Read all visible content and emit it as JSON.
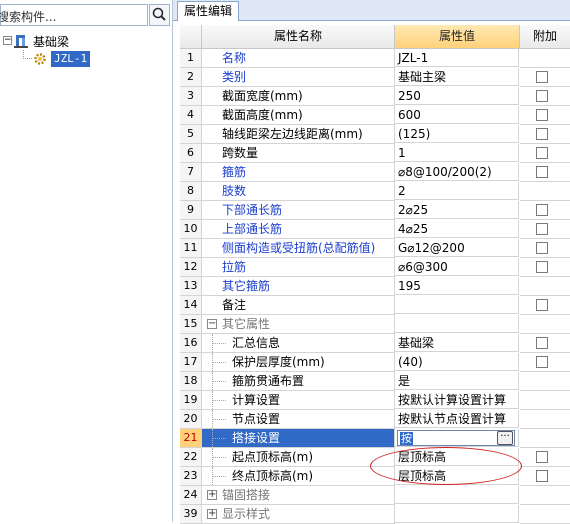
{
  "left_panel": {
    "search_placeholder": "搜索构件...",
    "tree": {
      "root_label": "基础梁",
      "child_label": "JZL-1"
    }
  },
  "right_panel": {
    "tab_label": "属性编辑",
    "headers": {
      "name": "属性名称",
      "value": "属性值",
      "extra": "附加"
    },
    "rows": [
      {
        "num": "1",
        "name": "名称",
        "value": "JZL-1",
        "style": "blue",
        "check": false
      },
      {
        "num": "2",
        "name": "类别",
        "value": "基础主梁",
        "style": "blue",
        "check": true
      },
      {
        "num": "3",
        "name": "截面宽度(mm)",
        "value": "250",
        "style": "normal",
        "check": true
      },
      {
        "num": "4",
        "name": "截面高度(mm)",
        "value": "600",
        "style": "normal",
        "check": true
      },
      {
        "num": "5",
        "name": "轴线距梁左边线距离(mm)",
        "value": "(125)",
        "style": "normal",
        "check": true
      },
      {
        "num": "6",
        "name": "跨数量",
        "value": "1",
        "style": "normal",
        "check": true
      },
      {
        "num": "7",
        "name": "箍筋",
        "value": "⌀8@100/200(2)",
        "style": "blue",
        "check": true
      },
      {
        "num": "8",
        "name": "肢数",
        "value": "2",
        "style": "blue",
        "check": false
      },
      {
        "num": "9",
        "name": "下部通长筋",
        "value": "2⌀25",
        "style": "blue",
        "check": true
      },
      {
        "num": "10",
        "name": "上部通长筋",
        "value": "4⌀25",
        "style": "blue",
        "check": true
      },
      {
        "num": "11",
        "name": "侧面构造或受扭筋(总配筋值)",
        "value": "G⌀12@200",
        "style": "blue",
        "check": true
      },
      {
        "num": "12",
        "name": "拉筋",
        "value": "⌀6@300",
        "style": "blue",
        "check": true
      },
      {
        "num": "13",
        "name": "其它箍筋",
        "value": "195",
        "style": "blue",
        "check": false
      },
      {
        "num": "14",
        "name": "备注",
        "value": "",
        "style": "normal",
        "check": true
      },
      {
        "num": "15",
        "name": "其它属性",
        "value": "",
        "style": "group",
        "check": false,
        "expander": "−"
      },
      {
        "num": "16",
        "name": "汇总信息",
        "value": "基础梁",
        "style": "sub",
        "check": true
      },
      {
        "num": "17",
        "name": "保护层厚度(mm)",
        "value": "(40)",
        "style": "sub",
        "check": true
      },
      {
        "num": "18",
        "name": "箍筋贯通布置",
        "value": "是",
        "style": "sub",
        "check": false
      },
      {
        "num": "19",
        "name": "计算设置",
        "value": "按默认计算设置计算",
        "style": "sub",
        "check": false
      },
      {
        "num": "20",
        "name": "节点设置",
        "value": "按默认节点设置计算",
        "style": "sub",
        "check": false
      },
      {
        "num": "21",
        "name": "搭接设置",
        "value": "",
        "style": "sub-selected",
        "check": false,
        "editing": true
      },
      {
        "num": "22",
        "name": "起点顶标高(m)",
        "value": "层顶标高",
        "style": "sub",
        "check": true
      },
      {
        "num": "23",
        "name": "终点顶标高(m)",
        "value": "层顶标高",
        "style": "sub",
        "check": true
      },
      {
        "num": "24",
        "name": "锚固搭接",
        "value": "",
        "style": "group",
        "check": false,
        "expander": "+"
      },
      {
        "num": "39",
        "name": "显示样式",
        "value": "",
        "style": "group",
        "check": false,
        "expander": "+"
      }
    ],
    "edit_cursor_text": "按",
    "edit_button_label": "···"
  },
  "colors": {
    "selection": "#3169c6",
    "value_header": "#ffd27a",
    "blue_text": "#1a3dcf",
    "annotation_ellipse": "#d02020"
  }
}
